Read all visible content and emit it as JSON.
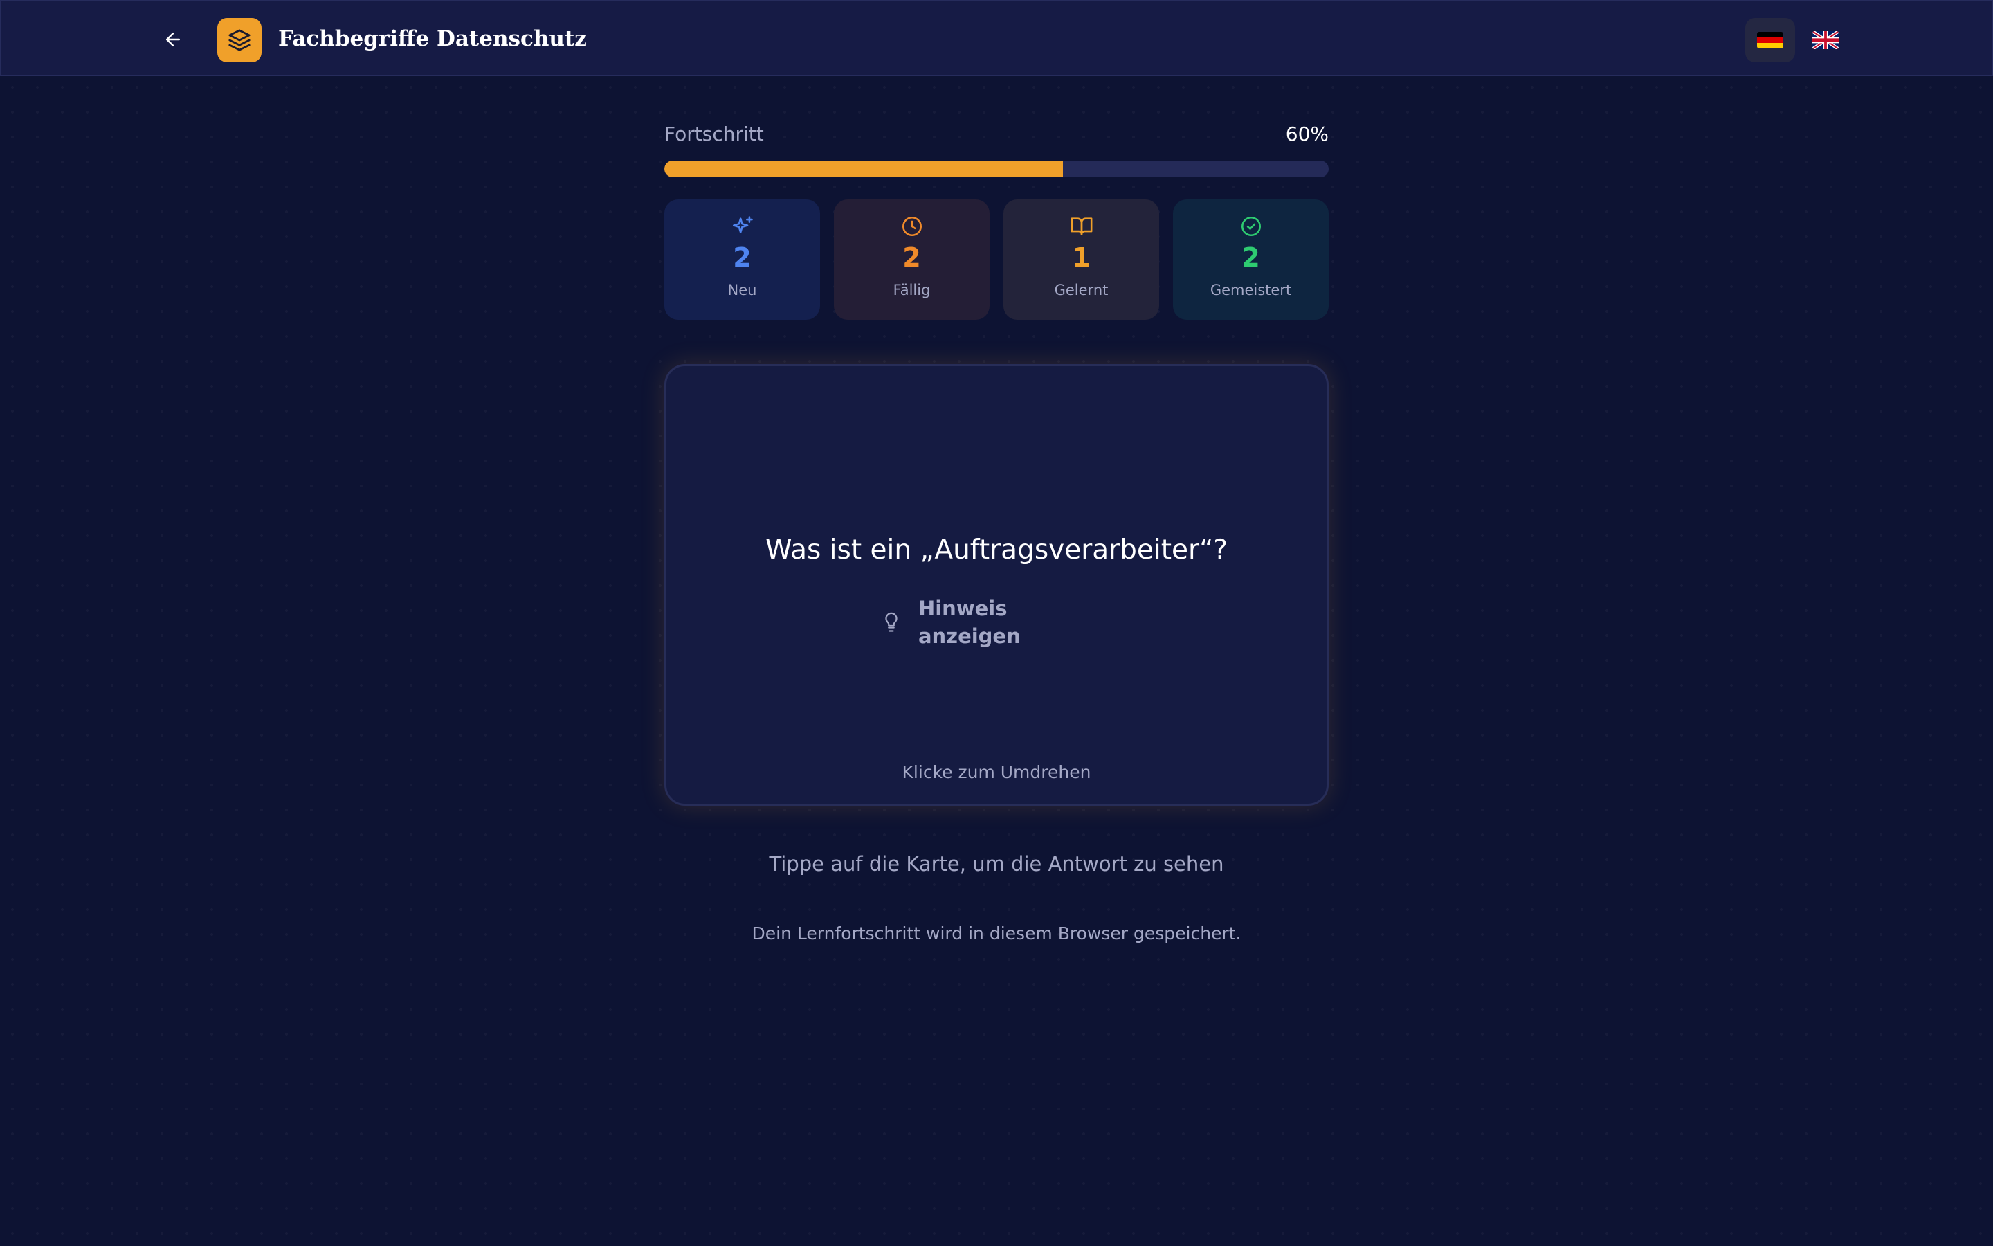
{
  "header": {
    "title": "Fachbegriffe Datenschutz",
    "back_icon": "arrow-left-icon",
    "logo_icon": "layers-icon",
    "languages": [
      {
        "code": "de",
        "icon": "flag-de-icon",
        "active": true
      },
      {
        "code": "en",
        "icon": "flag-gb-icon",
        "active": false
      }
    ]
  },
  "progress": {
    "label": "Fortschritt",
    "value_text": "60%",
    "fraction": 0.6,
    "color": "#f0a02a"
  },
  "stats": [
    {
      "key": "new",
      "count": "2",
      "label": "Neu",
      "icon": "sparkles-icon",
      "color": "#4f84f0"
    },
    {
      "key": "due",
      "count": "2",
      "label": "Fällig",
      "icon": "clock-icon",
      "color": "#f08a2a"
    },
    {
      "key": "learned",
      "count": "1",
      "label": "Gelernt",
      "icon": "book-open-icon",
      "color": "#f0a02a"
    },
    {
      "key": "mastered",
      "count": "2",
      "label": "Gemeistert",
      "icon": "check-circle-icon",
      "color": "#2ecc71"
    }
  ],
  "card": {
    "question": "Was ist ein „Auftragsverarbeiter“?",
    "hint_label": "Hinweis anzeigen",
    "hint_icon": "lightbulb-icon",
    "flip_hint": "Klicke zum Umdrehen"
  },
  "footer": {
    "tap_text": "Tippe auf die Karte, um die Antwort zu sehen",
    "storage_note": "Dein Lernfortschritt wird in diesem Browser gespeichert."
  }
}
